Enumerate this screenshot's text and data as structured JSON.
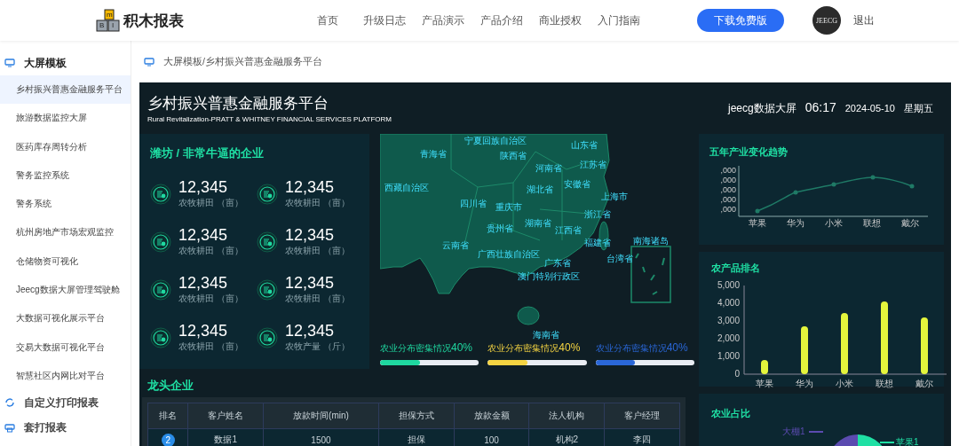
{
  "header": {
    "logo": {
      "letters": [
        "m",
        "B",
        "I"
      ],
      "text": "积木报表"
    },
    "nav": [
      {
        "label": "首页"
      },
      {
        "label": "升级日志"
      },
      {
        "label": "产品演示"
      },
      {
        "label": "产品介绍"
      },
      {
        "label": "商业授权"
      },
      {
        "label": "入门指南"
      }
    ],
    "download_button": "下载免费版",
    "avatar_text": "JEECG",
    "logout": "退出"
  },
  "sidebar": {
    "groups": [
      {
        "title": "大屏模板",
        "expanded": true,
        "items": [
          {
            "label": "乡村振兴普惠金融服务平台",
            "selected": true
          },
          {
            "label": "旅游数据监控大屏",
            "selected": false
          },
          {
            "label": "医药库存周转分析",
            "selected": false
          },
          {
            "label": "警务监控系统",
            "selected": false
          },
          {
            "label": "警务系统",
            "selected": false
          },
          {
            "label": "杭州房地产市场宏观监控",
            "selected": false
          },
          {
            "label": "仓储物资可视化",
            "selected": false
          },
          {
            "label": "Jeecg数据大屏管理驾驶舱",
            "selected": false
          },
          {
            "label": "大数据可视化展示平台",
            "selected": false
          },
          {
            "label": "交易大数据可视化平台",
            "selected": false
          },
          {
            "label": "智慧社区内网比对平台",
            "selected": false
          }
        ]
      },
      {
        "title": "自定义打印报表",
        "expanded": false
      },
      {
        "title": "套打报表",
        "expanded": false
      }
    ]
  },
  "breadcrumb": "大屏模板/乡村振兴普惠金融服务平台",
  "dashboard": {
    "title": "乡村振兴普惠金融服务平台",
    "subtitle": "Rural Revitalization-PRATT & WHITNEY FINANCIAL SERVICES PLATFORM",
    "brand": "jeecg数据大屏",
    "time": "06:17",
    "date": "2024-05-10",
    "weekday": "星期五",
    "stats_title": "潍坊 / 非常牛逼的企业",
    "stats": [
      {
        "value": "12,345",
        "label": "农牧耕田 （亩）"
      },
      {
        "value": "12,345",
        "label": "农牧耕田 （亩）"
      },
      {
        "value": "12,345",
        "label": "农牧耕田 （亩）"
      },
      {
        "value": "12,345",
        "label": "农牧耕田 （亩）"
      },
      {
        "value": "12,345",
        "label": "农牧耕田 （亩）"
      },
      {
        "value": "12,345",
        "label": "农牧耕田 （亩）"
      },
      {
        "value": "12,345",
        "label": "农牧耕田 （亩）"
      },
      {
        "value": "12,345",
        "label": "农牧产量 （斤）"
      }
    ],
    "map_labels": [
      "青海省",
      "宁夏回族自治区",
      "陕西省",
      "山东省",
      "河南省",
      "江苏省",
      "安徽省",
      "西藏自治区",
      "湖北省",
      "上海市",
      "四川省",
      "重庆市",
      "浙江省",
      "贵州省",
      "湖南省",
      "江西省",
      "云南省",
      "福建省",
      "广西壮族自治区",
      "广东省",
      "澳门特别行政区",
      "台湾省",
      "南海诸岛",
      "海南省"
    ],
    "progress": [
      {
        "label": "农业分布密集情况",
        "value": "40%",
        "level": 0.4,
        "color": "#1fd8a0"
      },
      {
        "label": "农业分布密集情况",
        "value": "40%",
        "level": 0.4,
        "color": "#f5d442"
      },
      {
        "label": "农业分布密集情况",
        "value": "40%",
        "level": 0.4,
        "color": "#2a67d8"
      }
    ],
    "table_title": "龙头企业",
    "table": {
      "columns": [
        "排名",
        "客户姓名",
        "放款时间(min)",
        "担保方式",
        "放款金额",
        "法人机构",
        "客户经理"
      ],
      "rows": [
        [
          "2",
          "数据1",
          "1500",
          "担保",
          "100",
          "机构2",
          "李四"
        ]
      ]
    },
    "trend": {
      "title": "五年产业变化趋势",
      "y_labels": [
        ",000",
        ",000",
        ",000",
        ",000",
        ",000"
      ],
      "categories": [
        "苹果",
        "华为",
        "小米",
        "联想",
        "戴尔"
      ]
    },
    "ranking": {
      "title": "农产品排名",
      "chart_data": {
        "type": "bar",
        "categories": [
          "苹果",
          "华为",
          "小米",
          "联想",
          "戴尔"
        ],
        "values": [
          800,
          2700,
          3450,
          4100,
          3200
        ],
        "ylim": [
          0,
          5000
        ],
        "yticks": [
          {
            "value": 0,
            "label": "0"
          },
          {
            "value": 1000,
            "label": "1,000"
          },
          {
            "value": 2000,
            "label": "2,000"
          },
          {
            "value": 3000,
            "label": "3,000"
          },
          {
            "value": 4000,
            "label": "4,000"
          },
          {
            "value": 5000,
            "label": "5,000"
          }
        ]
      }
    },
    "share": {
      "title": "农业占比",
      "labels": [
        {
          "text": "大棚1",
          "color": "#5b4bb0"
        },
        {
          "text": "苹果1",
          "color": "#1fe0a4"
        }
      ]
    }
  }
}
